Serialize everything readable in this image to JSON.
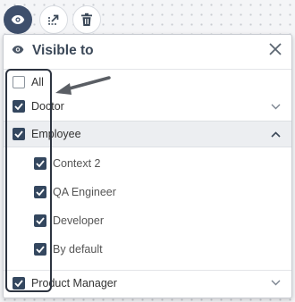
{
  "toolbar": {
    "visibility_icon": "eye-icon",
    "share_icon": "share-icon",
    "delete_icon": "trash-icon"
  },
  "panel": {
    "title": "Visible to",
    "title_icon": "eye-icon",
    "close_icon": "close-icon"
  },
  "options": {
    "all": {
      "label": "All",
      "checked": false
    },
    "doctor": {
      "label": "Doctor",
      "checked": true,
      "expanded": false
    },
    "employee": {
      "label": "Employee",
      "checked": true,
      "expanded": true,
      "children": [
        {
          "label": "Context 2",
          "checked": true
        },
        {
          "label": "QA Engineer",
          "checked": true
        },
        {
          "label": "Developer",
          "checked": true
        },
        {
          "label": "By default",
          "checked": true
        }
      ]
    },
    "product_manager": {
      "label": "Product Manager",
      "checked": true,
      "expanded": false
    }
  },
  "colors": {
    "accent": "#34475f",
    "header_text": "#3b4858",
    "expanded_bg": "#eceef1"
  }
}
